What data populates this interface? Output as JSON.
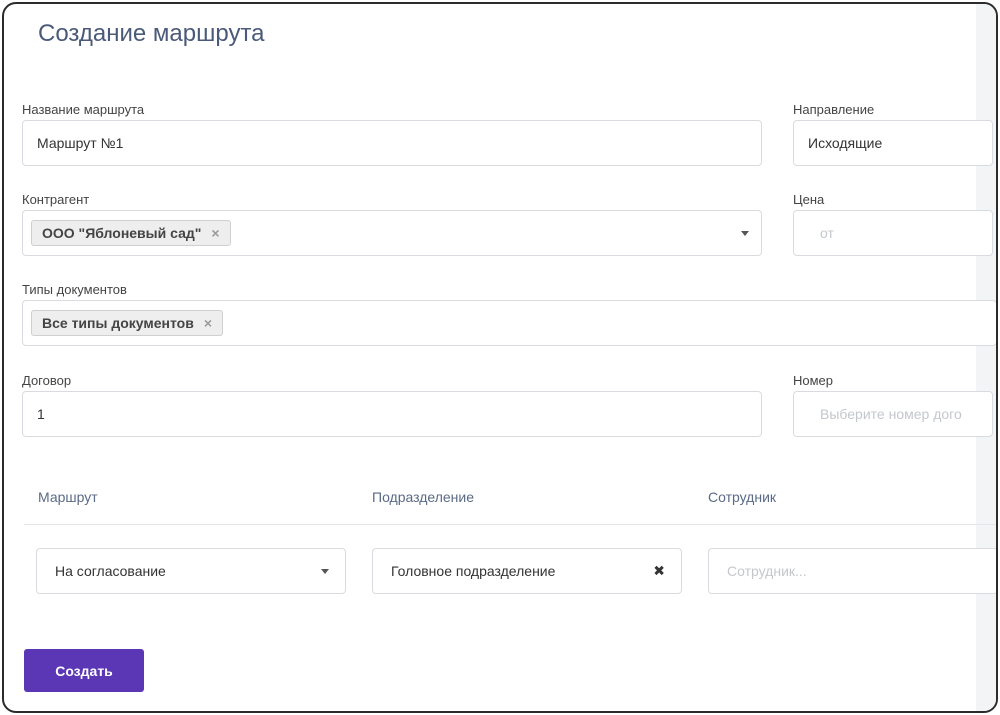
{
  "page": {
    "title": "Создание маршрута"
  },
  "form": {
    "route_name": {
      "label": "Название маршрута",
      "value": "Маршрут №1"
    },
    "direction": {
      "label": "Направление",
      "value": "Исходящие"
    },
    "counterparty": {
      "label": "Контрагент",
      "chip": "ООО \"Яблоневый сад\""
    },
    "price": {
      "label": "Цена",
      "placeholder": "от"
    },
    "doc_types": {
      "label": "Типы документов",
      "chip": "Все типы документов"
    },
    "contract": {
      "label": "Договор",
      "value": "1"
    },
    "number": {
      "label": "Номер",
      "placeholder": "Выберите номер дого"
    }
  },
  "route_table": {
    "headers": {
      "route": "Маршрут",
      "department": "Подразделение",
      "employee": "Сотрудник"
    },
    "row": {
      "route_value": "На согласование",
      "department_value": "Головное подразделение",
      "employee_placeholder": "Сотрудник..."
    }
  },
  "actions": {
    "create_label": "Создать"
  },
  "icons": {
    "chip_remove": "×",
    "clear": "✖"
  },
  "colors": {
    "primary_button": "#5b36b5",
    "title": "#4a5a78"
  }
}
